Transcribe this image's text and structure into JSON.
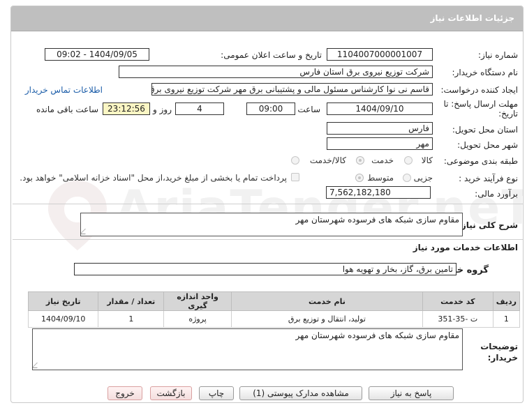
{
  "header": {
    "title": "جزئیات اطلاعات نیاز"
  },
  "watermark": {
    "text": "AriaTender.neT"
  },
  "form": {
    "need_number": {
      "label": "شماره نیاز:",
      "value": "1104007000001007"
    },
    "announce_datetime": {
      "label": "تاریخ و ساعت اعلان عمومی:",
      "value": "1404/09/05 - 09:02"
    },
    "buyer_org": {
      "label": "نام دستگاه خریدار:",
      "value": "شرکت توزیع نیروی برق استان فارس"
    },
    "requester": {
      "label": "ایجاد کننده درخواست:",
      "value": "قاسم نی نوا کارشناس مسئول مالی و پشتیبانی برق مهر شرکت توزیع نیروی برق",
      "contact_link": "اطلاعات تماس خریدار"
    },
    "deadline": {
      "label": "مهلت ارسال پاسخ: تا تاریخ:",
      "date": "1404/09/10",
      "time_label": "ساعت",
      "time": "09:00",
      "days": "4",
      "days_label": "روز و",
      "remaining": "23:12:56",
      "remaining_label": "ساعت باقی مانده"
    },
    "province": {
      "label": "استان محل تحویل:",
      "value": "فارس"
    },
    "city": {
      "label": "شهر محل تحویل:",
      "value": "مهر"
    },
    "category": {
      "label": "طبقه بندی موضوعی:",
      "options": [
        "کالا",
        "خدمت",
        "کالا/خدمت"
      ],
      "selected": "خدمت"
    },
    "process_type": {
      "label": "نوع فرآیند خرید :",
      "options": [
        "جزیی",
        "متوسط"
      ],
      "selected": "متوسط",
      "payment_note": "پرداخت تمام یا بخشی از مبلغ خرید،از محل \"اسناد خزانه اسلامی\" خواهد بود."
    },
    "budget": {
      "label": "برآورد مالی:",
      "value": "7,562,182,180"
    }
  },
  "description": {
    "label": "شرح کلی نیاز:",
    "value": "مقاوم سازی شبکه های فرسوده شهرستان مهر"
  },
  "services": {
    "section_title": "اطلاعات خدمات مورد نیاز",
    "group_label": "گروه خدمت:",
    "group_value": "تامین برق، گاز، بخار و تهویه هوا",
    "columns": [
      "ردیف",
      "کد خدمت",
      "نام خدمت",
      "واحد اندازه گیری",
      "تعداد / مقدار",
      "تاریخ نیاز"
    ],
    "rows": [
      {
        "row": "1",
        "code": "ت -35-351",
        "name": "تولید، انتقال و توزیع برق",
        "unit": "پروژه",
        "qty": "1",
        "date": "1404/09/10"
      }
    ]
  },
  "buyer_notes": {
    "label": "توضیحات خریدار:",
    "value": "مقاوم سازی شبکه های فرسوده شهرستان مهر"
  },
  "buttons": {
    "reply": "پاسخ به نیاز",
    "attachments": "مشاهده مدارک پیوستی (1)",
    "print": "چاپ",
    "back": "بازگشت",
    "exit": "خروج"
  }
}
